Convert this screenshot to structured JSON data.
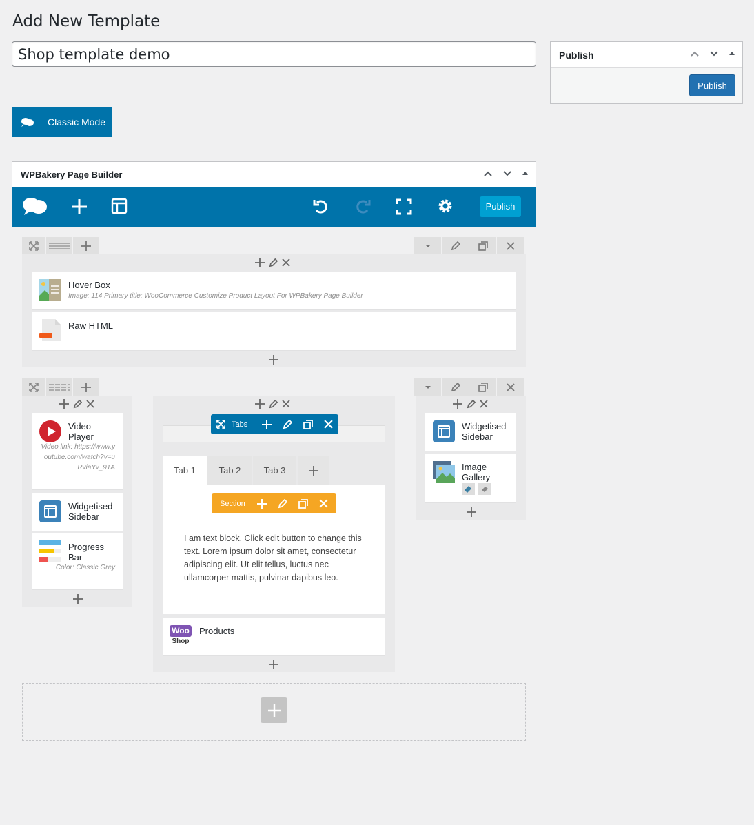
{
  "page": {
    "title": "Add New Template"
  },
  "post_title": {
    "value": "Shop template demo"
  },
  "publish_box": {
    "title": "Publish",
    "button": "Publish"
  },
  "classic_mode": {
    "label": "Classic Mode"
  },
  "builder": {
    "title": "WPBakery Page Builder",
    "toolbar": {
      "publish_label": "Publish"
    },
    "row1": {
      "elements": [
        {
          "title": "Hover Box",
          "subtitle": "Image: 114  Primary title: WooCommerce Customize Product Layout For WPBakery Page Builder",
          "icon": "hover-box-icon"
        },
        {
          "title": "Raw HTML",
          "icon": "raw-html-icon"
        }
      ]
    },
    "row2": {
      "left": [
        {
          "title": "Video Player",
          "subtitle": "Video link: https://www.youtube.com/watch?v=uRviaYv_91A",
          "icon": "video-player-icon"
        },
        {
          "title": "Widgetised Sidebar",
          "icon": "widgetised-sidebar-icon"
        },
        {
          "title": "Progress Bar",
          "subtitle": "Color: Classic Grey",
          "icon": "progress-bar-icon"
        }
      ],
      "center": {
        "tabs_label": "Tabs",
        "tabs": [
          "Tab 1",
          "Tab 2",
          "Tab 3"
        ],
        "section_label": "Section",
        "text_block": "I am text block. Click edit button to change this text. Lorem ipsum dolor sit amet, consectetur adipiscing elit. Ut elit tellus, luctus nec ullamcorper mattis, pulvinar dapibus leo.",
        "products": {
          "title": "Products",
          "icon_text_top": "Woo",
          "icon_text_bottom": "Shop"
        }
      },
      "right": [
        {
          "title": "Widgetised Sidebar",
          "icon": "widgetised-sidebar-icon"
        },
        {
          "title": "Image Gallery",
          "icon": "image-gallery-icon"
        }
      ]
    }
  },
  "colors": {
    "primary": "#0073aa",
    "accent": "#00a0d2",
    "section": "#f5a623",
    "canvas": "#f0f0f1"
  }
}
